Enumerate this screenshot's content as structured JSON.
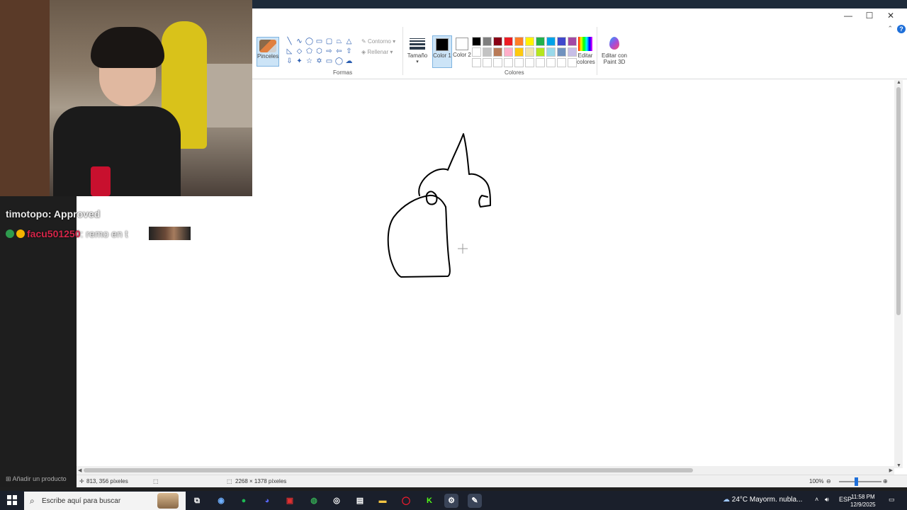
{
  "paint": {
    "ribbon": {
      "brushes_label": "Pinceles",
      "shapes_group_label": "Formas",
      "outline_label": "Contorno",
      "fill_label": "Rellenar",
      "size_label": "Tamaño",
      "color1_label": "Color 1",
      "color2_label": "Color 2",
      "colors_group_label": "Colores",
      "edit_colors_label": "Editar colores",
      "edit_paint3d_label": "Editar con Paint 3D",
      "color1_value": "#000000",
      "color2_value": "#ffffff",
      "palette_row1": [
        "#000000",
        "#7f7f7f",
        "#880015",
        "#ed1c24",
        "#ff7f27",
        "#fff200",
        "#22b14c",
        "#00a2e8",
        "#3f48cc",
        "#a349a4"
      ],
      "palette_row2": [
        "#ffffff",
        "#c3c3c3",
        "#b97a57",
        "#ffaec9",
        "#ffc90e",
        "#efe4b0",
        "#b5e61d",
        "#99d9ea",
        "#7092be",
        "#c8bfe7"
      ],
      "palette_row3": [
        "#ffffff",
        "#ffffff",
        "#ffffff",
        "#ffffff",
        "#ffffff",
        "#ffffff",
        "#ffffff",
        "#ffffff",
        "#ffffff",
        "#ffffff"
      ],
      "help_label": "?"
    },
    "status": {
      "cursor_position": "813, 356 píxeles",
      "canvas_size": "2268 × 1378 píxeles",
      "zoom": "100%"
    }
  },
  "chat": {
    "messages": [
      {
        "user": "timotopo",
        "text": ": Approved",
        "user_color": "#e8e8e8"
      },
      {
        "user": "facu501250",
        "text": ": remo en t",
        "user_color": "#d6264a"
      }
    ],
    "add_product_label": "Añadir un producto"
  },
  "taskbar": {
    "search_placeholder": "Escribe aquí para buscar",
    "weather": "24°C  Mayorm. nubla...",
    "language": "ESP",
    "time": "11:58 PM",
    "date": "12/9/2025"
  }
}
